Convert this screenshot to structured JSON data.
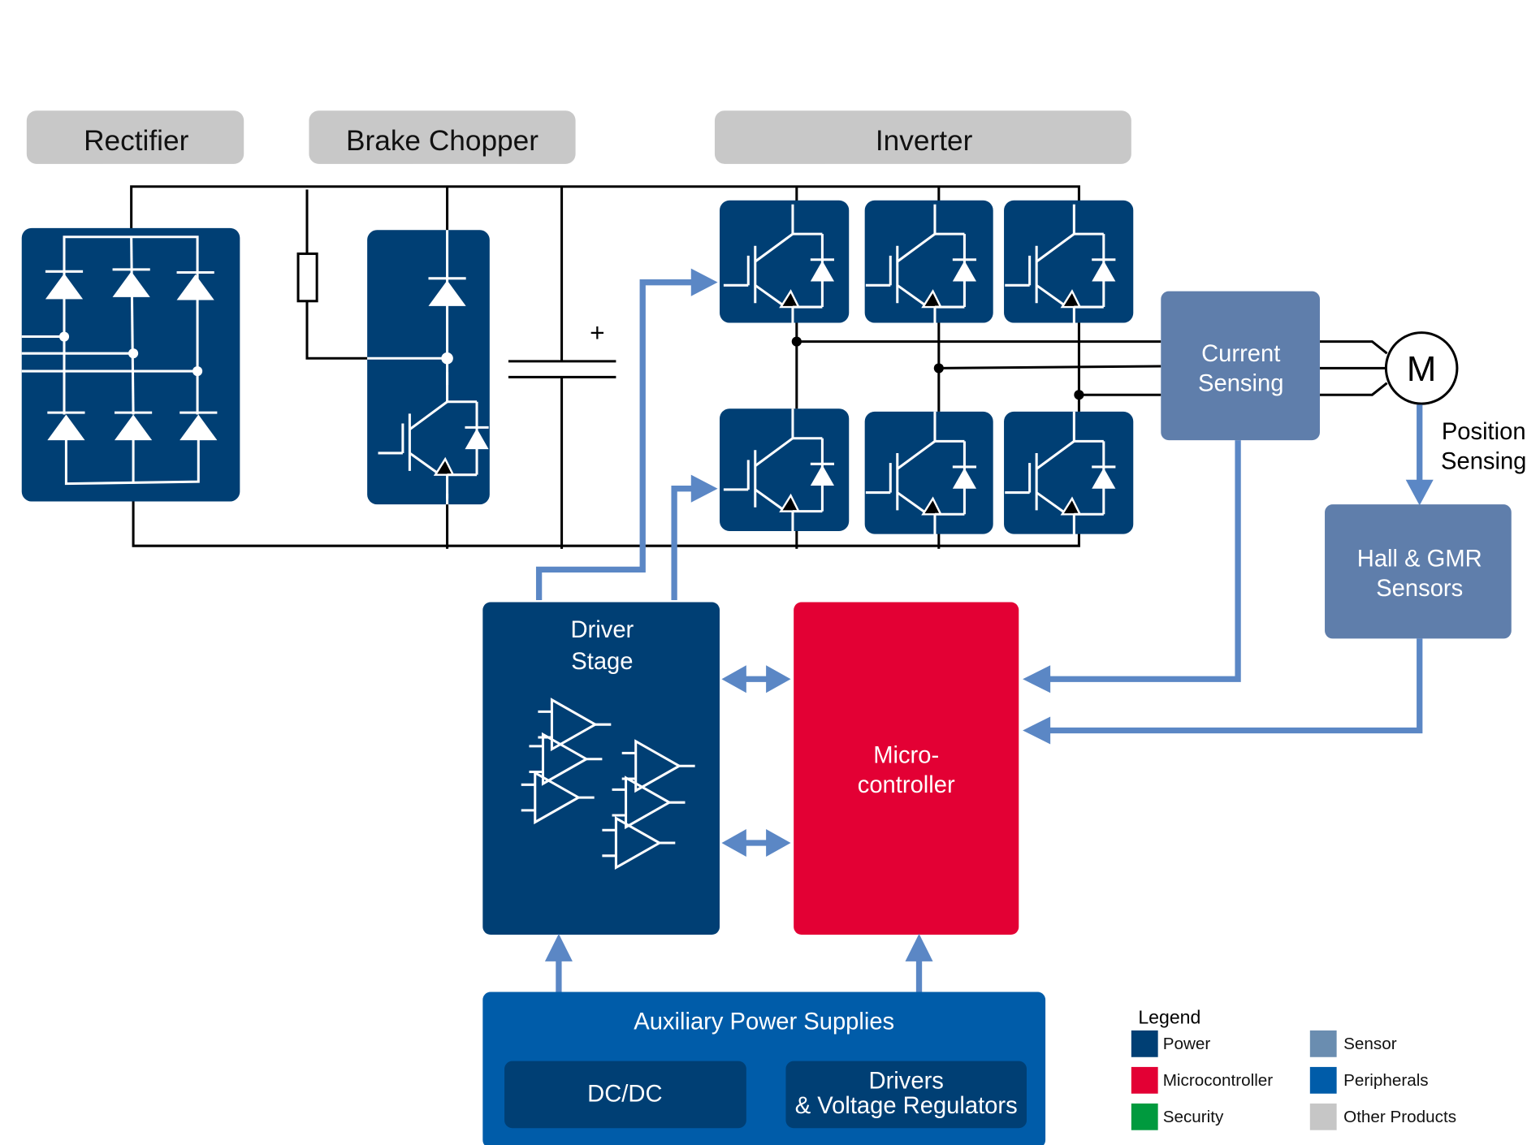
{
  "section_labels": {
    "rectifier": "Rectifier",
    "brake_chopper": "Brake Chopper",
    "inverter": "Inverter"
  },
  "capacitor_polarity": "+",
  "current_sensing": {
    "line1": "Current",
    "line2": "Sensing"
  },
  "motor": "M",
  "position_sensing": {
    "line1": "Position",
    "line2": "Sensing"
  },
  "hall_gmr": {
    "line1": "Hall & GMR",
    "line2": "Sensors"
  },
  "driver_stage": {
    "line1": "Driver",
    "line2": "Stage"
  },
  "microcontroller": {
    "line1": "Micro-",
    "line2": "controller"
  },
  "aux_power": {
    "title": "Auxiliary Power Supplies",
    "dcdc": "DC/DC",
    "drivers_line1": "Drivers",
    "drivers_line2": "& Voltage Regulators"
  },
  "legend": {
    "title": "Legend",
    "items": [
      {
        "label": "Power",
        "color": "#003F74"
      },
      {
        "label": "Microcontroller",
        "color": "#E30034"
      },
      {
        "label": "Security",
        "color": "#009A3E"
      },
      {
        "label": "Sensor",
        "color": "#6A8DB0"
      },
      {
        "label": "Peripherals",
        "color": "#005CA9"
      },
      {
        "label": "Other Products",
        "color": "#C6C6C6"
      }
    ]
  },
  "colors": {
    "power": "#003F74",
    "microcontroller": "#E30034",
    "sensor": "#5F7EAB",
    "peripherals": "#005CA9",
    "other": "#C8C8C8",
    "signal_arrow": "#5B87C5"
  }
}
